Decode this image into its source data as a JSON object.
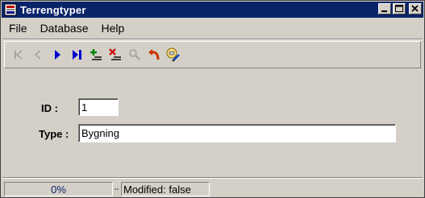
{
  "window": {
    "title": "Terrengtyper"
  },
  "menu": {
    "items": [
      "File",
      "Database",
      "Help"
    ]
  },
  "toolbar": {
    "buttons": [
      {
        "name": "first-record-icon",
        "enabled": false
      },
      {
        "name": "previous-record-icon",
        "enabled": false
      },
      {
        "name": "next-record-icon",
        "enabled": true
      },
      {
        "name": "last-record-icon",
        "enabled": true
      },
      {
        "name": "add-record-icon",
        "enabled": true
      },
      {
        "name": "delete-record-icon",
        "enabled": true
      },
      {
        "name": "find-icon",
        "enabled": false
      },
      {
        "name": "undo-icon",
        "enabled": true
      },
      {
        "name": "save-icon",
        "enabled": true
      }
    ]
  },
  "form": {
    "id_label": "ID :",
    "id_value": "1",
    "type_label": "Type :",
    "type_value": "Bygning"
  },
  "status": {
    "progress": "0%",
    "modified": "Modified: false"
  },
  "colors": {
    "titlebar": "#0a246a",
    "face": "#d4d0c8",
    "nav_blue": "#0000cc"
  }
}
